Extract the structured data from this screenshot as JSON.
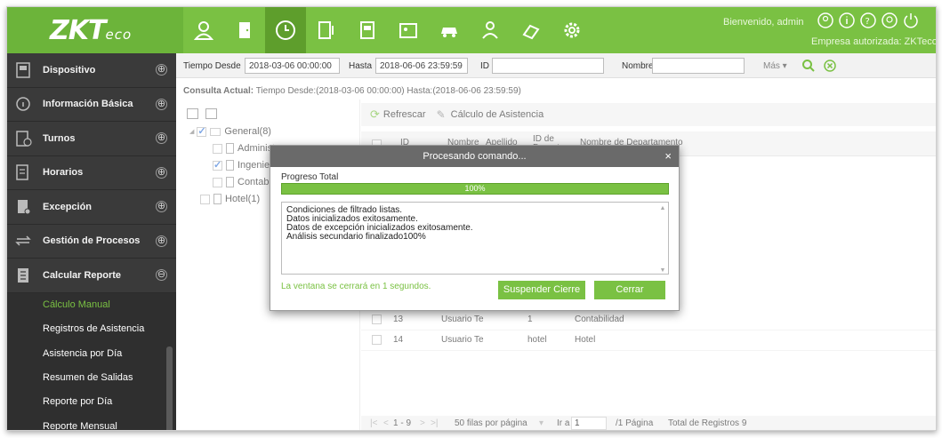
{
  "header": {
    "logo_main": "ZKT",
    "logo_sub": "eco",
    "welcome": "Bienvenido, admin",
    "company": "Empresa autorizada: ZKTeco",
    "modules": [
      "personnel-icon",
      "door-icon",
      "clock-icon",
      "access-icon",
      "badge-icon",
      "id-card-icon",
      "car-icon",
      "visitor-icon",
      "patrol-icon",
      "gear-icon"
    ],
    "active_module": 2
  },
  "sidebar": {
    "items": [
      {
        "label": "Dispositivo",
        "icon": "device-icon",
        "toggle": "⊕"
      },
      {
        "label": "Información Básica",
        "icon": "info-icon",
        "toggle": "⊕"
      },
      {
        "label": "Turnos",
        "icon": "shift-icon",
        "toggle": "⊕"
      },
      {
        "label": "Horarios",
        "icon": "schedule-icon",
        "toggle": "⊕"
      },
      {
        "label": "Excepción",
        "icon": "exception-icon",
        "toggle": "⊕"
      },
      {
        "label": "Gestión de Procesos",
        "icon": "process-icon",
        "toggle": "⊕"
      },
      {
        "label": "Calcular Reporte",
        "icon": "report-icon",
        "toggle": "⊖"
      }
    ],
    "submenu": [
      {
        "label": "Cálculo Manual",
        "active": true
      },
      {
        "label": "Registros de Asistencia"
      },
      {
        "label": "Asistencia por Día"
      },
      {
        "label": "Resumen de Salidas"
      },
      {
        "label": "Reporte por Día"
      },
      {
        "label": "Reporte Mensual"
      }
    ]
  },
  "search": {
    "from_label": "Tiempo Desde",
    "from_value": "2018-03-06 00:00:00",
    "to_label": "Hasta",
    "to_value": "2018-06-06 23:59:59",
    "id_label": "ID",
    "id_value": "",
    "name_label": "Nombre",
    "name_value": "",
    "more_label": "Más ▾"
  },
  "consulta": {
    "label": "Consulta Actual:",
    "text": "Tiempo Desde:(2018-03-06 00:00:00)  Hasta:(2018-06-06 23:59:59)"
  },
  "tree": {
    "root": "General(8)",
    "children": [
      "Administr",
      "Ingeniería",
      "Contabili"
    ],
    "other": "Hotel(1)"
  },
  "grid": {
    "refresh": "Refrescar",
    "calc": "Cálculo de Asistencia",
    "columns": [
      "ID",
      "Nombre",
      "Apellido",
      "ID de Departamento",
      "Nombre de Departamento"
    ],
    "rows": [
      {
        "id": "13",
        "name": "Usuario Te",
        "dept_id": "1",
        "dept_name": "Contabilidad"
      },
      {
        "id": "14",
        "name": "Usuario Te",
        "dept_id": "hotel",
        "dept_name": "Hotel"
      }
    ]
  },
  "pager": {
    "range": "1 - 9",
    "rows_per_page": "50 filas por página",
    "goto_label": "Ir a",
    "goto_value": "1",
    "pages": "/1 Página",
    "total": "Total de Registros 9"
  },
  "dialog": {
    "title": "Procesando comando...",
    "close": "×",
    "progress_label": "Progreso Total",
    "progress_text": "100%",
    "progress_value": 1.0,
    "log": [
      "Condiciones de filtrado listas.",
      "Datos inicializados exitosamente.",
      "Datos de excepción inicializados exitosamente.",
      "Análisis secundario finalizado100%"
    ],
    "countdown": "La ventana se cerrará en 1 segundos.",
    "suspend_button": "Suspender Cierre",
    "close_button": "Cerrar"
  },
  "colors": {
    "brand_green": "#7ac143",
    "sidebar_bg": "#3a3a3a",
    "dialog_title_bg": "#6a6a6a"
  }
}
